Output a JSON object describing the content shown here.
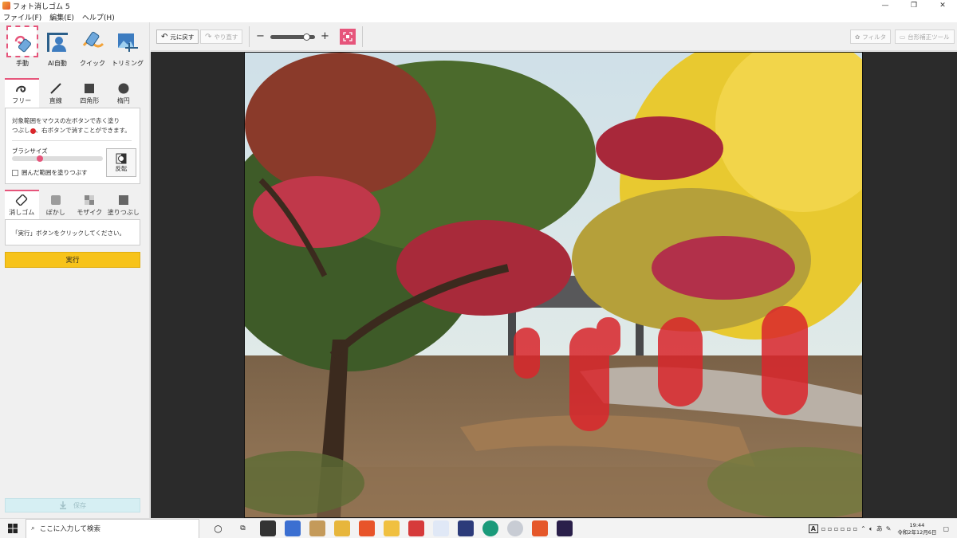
{
  "window": {
    "title": "フォト消しゴム 5",
    "min": "—",
    "max": "❐",
    "close": "✕"
  },
  "menu": [
    "ファイル(F)",
    "編集(E)",
    "ヘルプ(H)"
  ],
  "modes": [
    {
      "label": "手動",
      "icon": "manual-eraser-icon",
      "active": true
    },
    {
      "label": "AI自動",
      "icon": "ai-auto-icon",
      "active": false
    },
    {
      "label": "クイック",
      "icon": "quick-icon",
      "active": false
    },
    {
      "label": "トリミング",
      "icon": "trimming-icon",
      "active": false
    }
  ],
  "select_tabs": [
    {
      "label": "フリー",
      "icon": "freehand-icon",
      "active": true
    },
    {
      "label": "直線",
      "icon": "line-icon",
      "active": false
    },
    {
      "label": "四角形",
      "icon": "rectangle-icon",
      "active": false
    },
    {
      "label": "楕円",
      "icon": "ellipse-icon",
      "active": false
    }
  ],
  "select_panel": {
    "desc_line1": "対象範囲をマウスの左ボタンで赤く塗り",
    "desc_line2a": "つぶし",
    "desc_line2b": "、右ボタンで消すことができます。",
    "brush_size_label": "ブラシサイズ",
    "brush_size_fraction": 0.31,
    "fill_enclosed_label": "囲んだ範囲を塗りつぶす",
    "fill_enclosed_checked": false,
    "invert_label": "反転"
  },
  "process_tabs": [
    {
      "label": "消しゴム",
      "icon": "eraser-icon",
      "active": true
    },
    {
      "label": "ぼかし",
      "icon": "blur-icon",
      "active": false
    },
    {
      "label": "モザイク",
      "icon": "mosaic-icon",
      "active": false
    },
    {
      "label": "塗りつぶし",
      "icon": "fill-icon",
      "active": false
    }
  ],
  "process_panel": {
    "hint": "「実行」ボタンをクリックしてください。"
  },
  "execute_label": "実行",
  "save_label": "保存",
  "toolbar": {
    "undo_label": "元に戻す",
    "redo_label": "やり直す",
    "zoom_minus": "−",
    "zoom_plus": "+",
    "zoom_fraction": 0.8,
    "filter_label": "フィルタ",
    "tilt_label": "台形補正ツール"
  },
  "taskbar": {
    "search_placeholder": "ここに入力して検索",
    "apps": [
      "cortana-icon",
      "task-view-icon",
      "store-icon",
      "mail-icon",
      "folder-icon",
      "app-icon",
      "brave-icon",
      "explorer-icon",
      "media-icon",
      "dice-icon",
      "app-icon-2",
      "groove-icon",
      "disc-icon",
      "photo-eraser-icon",
      "vix-icon"
    ],
    "tray_text": "A",
    "ime": "あ",
    "time": "19:44",
    "date": "令和2年12月6日"
  },
  "colors": {
    "accent": "#e6557b",
    "execute": "#f7c31a",
    "mask": "#d9262b"
  }
}
